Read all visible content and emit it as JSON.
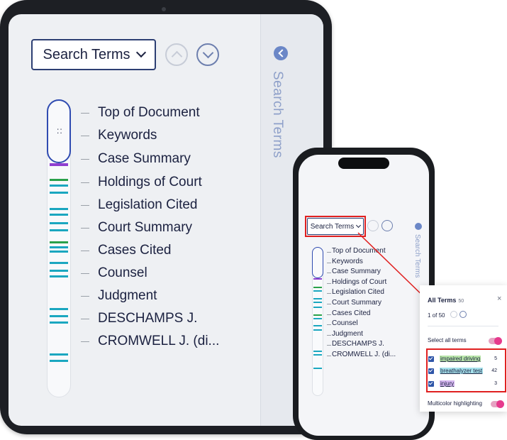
{
  "colors": {
    "navy": "#2d3f73",
    "viewport_blue": "#2f4bb1",
    "teal": "#1ba7c0",
    "green": "#2aa14a",
    "purple": "#8f3fd0",
    "red_highlight": "#e02020",
    "toggle_pink": "#e63a8d"
  },
  "tablet": {
    "search_button_label": "Search Terms",
    "side_tab_label": "Search Terms",
    "rows": [
      {
        "label": "Top of Document"
      },
      {
        "label": "Keywords"
      },
      {
        "label": "Case Summary"
      },
      {
        "label": "Holdings of Court"
      },
      {
        "label": "Legislation Cited"
      },
      {
        "label": "Court Summary"
      },
      {
        "label": "Cases Cited"
      },
      {
        "label": "Counsel"
      },
      {
        "label": "Judgment"
      },
      {
        "label": "DESCHAMPS J."
      },
      {
        "label": "CROMWELL J. (di..."
      }
    ]
  },
  "phone": {
    "search_button_label": "Search Terms",
    "side_tab_label": "Search Terms",
    "rows": [
      {
        "label": "Top of Document"
      },
      {
        "label": "Keywords"
      },
      {
        "label": "Case Summary"
      },
      {
        "label": "Holdings of Court"
      },
      {
        "label": "Legislation Cited"
      },
      {
        "label": "Court Summary"
      },
      {
        "label": "Cases Cited"
      },
      {
        "label": "Counsel"
      },
      {
        "label": "Judgment"
      },
      {
        "label": "DESCHAMPS J."
      },
      {
        "label": "CROMWELL J. (di..."
      }
    ]
  },
  "popup": {
    "title": "All Terms",
    "total_count": "50",
    "close_icon": "×",
    "nav_text": "1 of 50",
    "select_all_label": "Select all terms",
    "select_all_on": true,
    "multicolor_label": "Multicolor highlighting",
    "multicolor_on": true,
    "terms": [
      {
        "label": "impaired driving",
        "count": "5",
        "highlight": "#b9e6a9",
        "checked": true
      },
      {
        "label": "breathalyzer test",
        "count": "42",
        "highlight": "#a6e2ec",
        "checked": true
      },
      {
        "label": "injury",
        "count": "3",
        "highlight": "#d6b7f0",
        "checked": true
      }
    ]
  }
}
